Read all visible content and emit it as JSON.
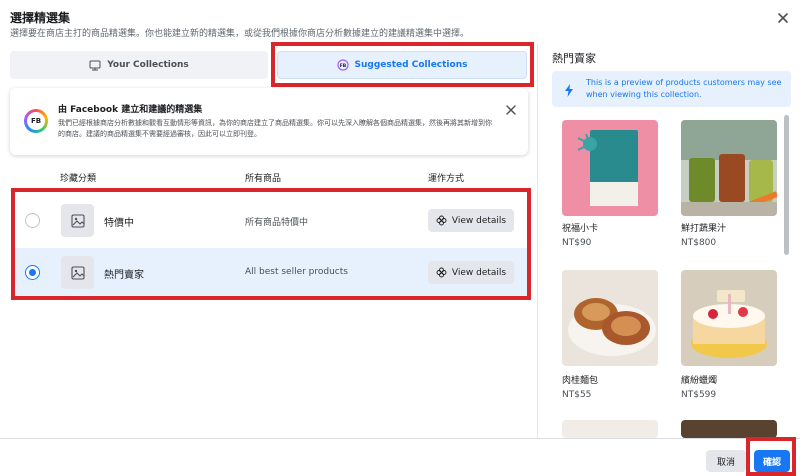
{
  "dialog": {
    "title": "選擇精選集",
    "subtitle": "選擇要在商店主打的商品精選集。你也能建立新的精選集，或從我們根據你商店分析數據建立的建議精選集中選擇。"
  },
  "tabs": [
    {
      "label": "Your Collections",
      "icon": "storefront-icon",
      "selected": false
    },
    {
      "label": "Suggested Collections",
      "icon": "fb-badge-icon",
      "selected": true
    }
  ],
  "info_card": {
    "badge": "FB",
    "title": "由 Facebook 建立和建議的精選集",
    "description": "我們已經根據商店分析數據和觀看互動情形等資訊，為你的商店建立了商品精選集。你可以先深入瞭解各個商品精選集，然後再將其新增到你的商店。建議的商品精選集不需要經過審核，因此可以立即刊登。"
  },
  "table": {
    "headers": [
      "珍藏分類",
      "所有商品",
      "運作方式"
    ],
    "rows": [
      {
        "name": "特價中",
        "description": "所有商品特價中",
        "action": "View details",
        "selected": false
      },
      {
        "name": "熱門賣家",
        "description": "All best seller products",
        "action": "View details",
        "selected": true
      }
    ]
  },
  "preview_panel": {
    "title": "熱門賣家",
    "notice": "This is a preview of products customers may see when viewing this collection.",
    "products": [
      {
        "name": "祝福小卡",
        "price": "NT$90"
      },
      {
        "name": "鮮打蔬果汁",
        "price": "NT$800"
      },
      {
        "name": "肉桂麵包",
        "price": "NT$55"
      },
      {
        "name": "繽紛蠟燭",
        "price": "NT$599"
      }
    ]
  },
  "footer": {
    "cancel_label": "取消",
    "confirm_label": "確認"
  },
  "colors": {
    "accent": "#1877f2",
    "highlight_box": "#d9262c",
    "selected_row_bg": "#e7f0fd"
  }
}
